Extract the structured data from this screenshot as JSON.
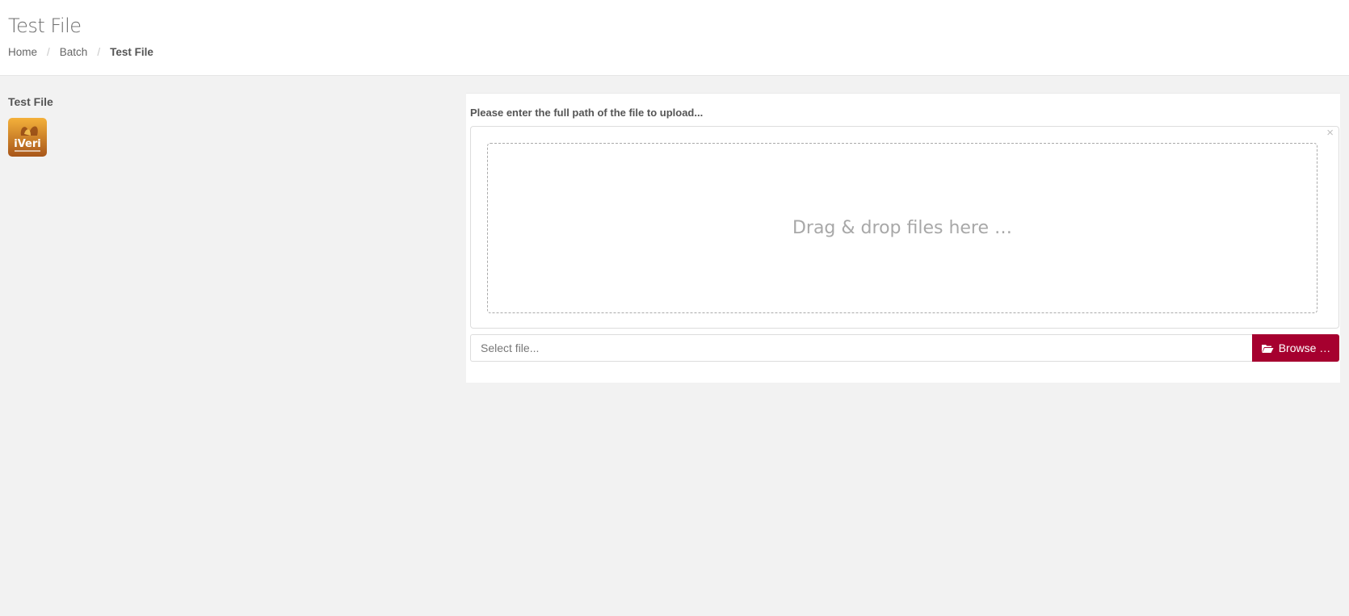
{
  "header": {
    "title": "Test File",
    "breadcrumb": {
      "items": [
        "Home",
        "Batch",
        "Test File"
      ],
      "separator": "/"
    }
  },
  "sidebar": {
    "title": "Test File",
    "logo": {
      "icon": "iveri-logo-icon",
      "text": "iVeri"
    }
  },
  "upload": {
    "label": "Please enter the full path of the file to upload...",
    "close_symbol": "×",
    "drop_text": "Drag & drop files here …",
    "input_placeholder": "Select file...",
    "browse_label": "Browse …",
    "browse_icon": "folder-open-icon"
  },
  "colors": {
    "accent": "#a6002f",
    "background": "#f2f2f2",
    "panel": "#ffffff"
  }
}
